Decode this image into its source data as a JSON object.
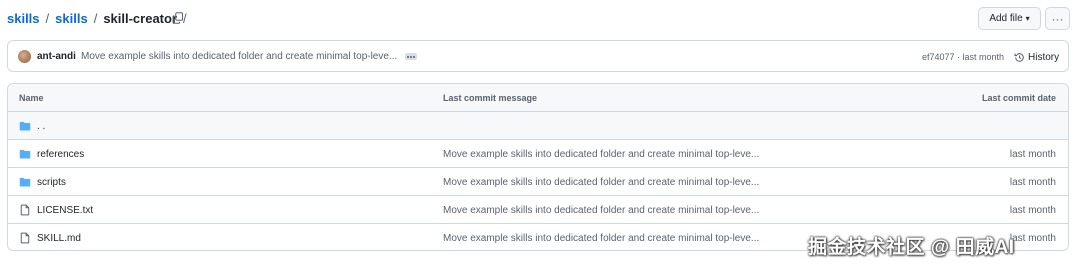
{
  "breadcrumb": {
    "parts": [
      "skills",
      "skills"
    ],
    "separator": "/",
    "current": "skill-creator",
    "trailing": "/"
  },
  "toolbar": {
    "add_file_label": "Add file",
    "add_file_caret": "▾",
    "more_label": "···"
  },
  "commit": {
    "author": "ant-andi",
    "message": "Move example skills into dedicated folder and create minimal top-leve...",
    "meta": "ef74077 · last month",
    "history_label": "History"
  },
  "table": {
    "headers": {
      "name": "Name",
      "message": "Last commit message",
      "date": "Last commit date"
    },
    "parent_label": ". .",
    "rows": [
      {
        "name": "references",
        "type": "folder",
        "message": "Move example skills into dedicated folder and create minimal top-leve...",
        "date": "last month"
      },
      {
        "name": "scripts",
        "type": "folder",
        "message": "Move example skills into dedicated folder and create minimal top-leve...",
        "date": "last month"
      },
      {
        "name": "LICENSE.txt",
        "type": "file",
        "message": "Move example skills into dedicated folder and create minimal top-leve...",
        "date": "last month"
      },
      {
        "name": "SKILL.md",
        "type": "file",
        "message": "Move example skills into dedicated folder and create minimal top-leve...",
        "date": "last month"
      }
    ]
  },
  "watermark": "掘金技术社区 @ 田威AI",
  "colors": {
    "link": "#0969da",
    "folder": "#54aeff",
    "border": "#d1d9e0",
    "muted": "#59636e"
  }
}
